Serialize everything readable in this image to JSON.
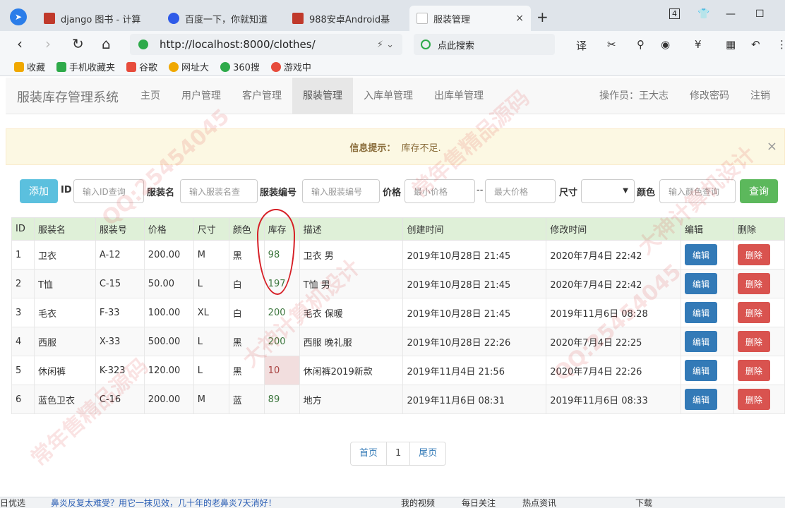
{
  "browser": {
    "tabs": [
      {
        "title": "django 图书 - 计算",
        "color": "#c0392b"
      },
      {
        "title": "百度一下，你就知道",
        "color": "#2e5ae8"
      },
      {
        "title": "988安卓Android基",
        "color": "#c0392b"
      },
      {
        "title": "服装管理",
        "color": "#bbbbbb",
        "close": "×"
      }
    ],
    "new_tab": "+",
    "tab_count": "4",
    "url": "http://localhost:8000/clothes/",
    "search_placeholder": "点此搜索",
    "bookmarks": [
      {
        "label": "收藏",
        "color": "#f0a800"
      },
      {
        "label": "手机收藏夹",
        "color": "#2eaa4a"
      },
      {
        "label": "谷歌",
        "color": "#e74c3c"
      },
      {
        "label": "网址大",
        "color": "#f0a800"
      },
      {
        "label": "360搜",
        "color": "#2eaa4a"
      },
      {
        "label": "游戏中",
        "color": "#e74c3c"
      }
    ]
  },
  "app": {
    "brand": "服装库存管理系统",
    "nav": [
      {
        "label": "主页",
        "active": false
      },
      {
        "label": "用户管理",
        "active": false
      },
      {
        "label": "客户管理",
        "active": false
      },
      {
        "label": "服装管理",
        "active": true
      },
      {
        "label": "入库单管理",
        "active": false
      },
      {
        "label": "出库单管理",
        "active": false
      }
    ],
    "operator": "操作员：王大志",
    "change_password": "修改密码",
    "logout": "注销"
  },
  "alert": {
    "title": "信息提示：",
    "message": "库存不足.",
    "close": "×"
  },
  "filters": {
    "add_label": "添加",
    "id_label": "ID",
    "id_placeholder": "输入ID查询",
    "name_label": "服装名",
    "name_placeholder": "输入服装名查",
    "code_label": "服装编号",
    "code_placeholder": "输入服装编号",
    "price_label": "价格",
    "min_price_placeholder": "最小价格",
    "range_sep": "--",
    "max_price_placeholder": "最大价格",
    "size_label": "尺寸",
    "size_value": "",
    "color_label": "颜色",
    "color_placeholder": "输入颜色查询",
    "search_label": "查询"
  },
  "table": {
    "headers": [
      "ID",
      "服装名",
      "服装号",
      "价格",
      "尺寸",
      "颜色",
      "库存",
      "描述",
      "创建时间",
      "修改时间",
      "编辑",
      "删除"
    ],
    "edit_label": "编辑",
    "delete_label": "删除",
    "rows": [
      {
        "id": "1",
        "name": "卫衣",
        "code": "A-12",
        "price": "200.00",
        "size": "M",
        "color": "黑",
        "stock": "98",
        "desc": "卫衣 男",
        "created": "2019年10月28日 21:45",
        "modified": "2020年7月4日 22:42",
        "low": false
      },
      {
        "id": "2",
        "name": "T恤",
        "code": "C-15",
        "price": "50.00",
        "size": "L",
        "color": "白",
        "stock": "197",
        "desc": "T恤 男",
        "created": "2019年10月28日 21:45",
        "modified": "2020年7月4日 22:42",
        "low": false
      },
      {
        "id": "3",
        "name": "毛衣",
        "code": "F-33",
        "price": "100.00",
        "size": "XL",
        "color": "白",
        "stock": "200",
        "desc": "毛衣 保暖",
        "created": "2019年10月28日 21:45",
        "modified": "2019年11月6日 08:28",
        "low": false
      },
      {
        "id": "4",
        "name": "西服",
        "code": "X-33",
        "price": "500.00",
        "size": "L",
        "color": "黑",
        "stock": "200",
        "desc": "西服 晚礼服",
        "created": "2019年10月28日 22:26",
        "modified": "2020年7月4日 22:25",
        "low": false
      },
      {
        "id": "5",
        "name": "休闲裤",
        "code": "K-323",
        "price": "120.00",
        "size": "L",
        "color": "黑",
        "stock": "10",
        "desc": "休闲裤2019新款",
        "created": "2019年11月4日 21:56",
        "modified": "2020年7月4日 22:26",
        "low": true
      },
      {
        "id": "6",
        "name": "蓝色卫衣",
        "code": "C-16",
        "price": "200.00",
        "size": "M",
        "color": "蓝",
        "stock": "89",
        "desc": "地方",
        "created": "2019年11月6日 08:31",
        "modified": "2019年11月6日 08:33",
        "low": false
      }
    ]
  },
  "pagination": {
    "first": "首页",
    "current": "1",
    "last": "尾页"
  },
  "statusbar": {
    "left": "日优选",
    "news": "鼻炎反复太难受？用它一抹见效，几十年的老鼻炎7天消好！",
    "video": "我的视频",
    "follow": "每日关注",
    "hot": "热点资讯",
    "download": "下载"
  },
  "watermark": [
    "QQ:25454045",
    "常年售精品源码",
    "大神计算机设计"
  ]
}
